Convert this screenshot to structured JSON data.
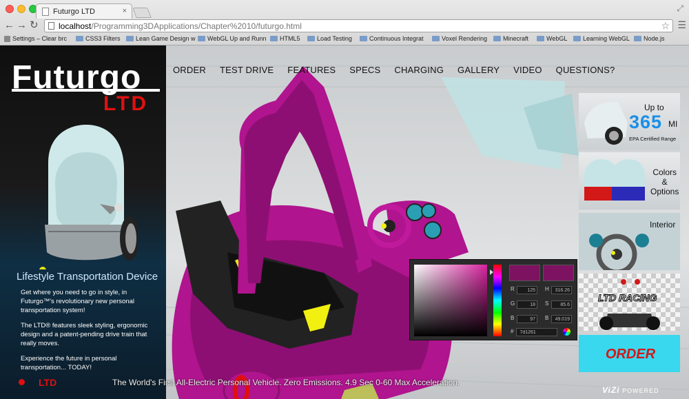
{
  "browser": {
    "tab_title": "Futurgo LTD",
    "tab_close": "×",
    "url_host": "localhost",
    "url_path": "/Programming3DApplications/Chapter%2010/futurgo.html",
    "bookmarks": [
      "Settings – Clear brc",
      "CSS3 Filters",
      "Lean Game Design w",
      "WebGL Up and Runn",
      "HTML5",
      "Load Testing",
      "Continuous Integrat",
      "Voxel Rendering",
      "Minecraft",
      "WebGL",
      "Learning WebGL",
      "Node.js"
    ]
  },
  "sidebar": {
    "logo": "Futurgo",
    "logo_sub": "LTD",
    "tagline": "Lifestyle Transportation Device",
    "paragraphs": [
      "Get where you need to go in style, in Futurgo™'s revolutionary new personal transportation system!",
      "The LTD® features sleek styling, ergonomic design and a patent-pending drive train that really moves.",
      "Experience the future in personal transportation... TODAY!"
    ],
    "footer_label": "LTD"
  },
  "nav": [
    "ORDER",
    "TEST DRIVE",
    "FEATURES",
    "SPECS",
    "CHARGING",
    "GALLERY",
    "VIDEO",
    "QUESTIONS?"
  ],
  "color_picker": {
    "swatch_color": "#7d1261",
    "fields": [
      {
        "label": "R",
        "value": "125"
      },
      {
        "label": "H",
        "value": "316.26"
      },
      {
        "label": "G",
        "value": "18"
      },
      {
        "label": "S",
        "value": "85.6"
      },
      {
        "label": "B",
        "value": "97"
      },
      {
        "label": "B",
        "value": "49.019"
      }
    ],
    "hex_label": "#",
    "hex_value": "7d1261"
  },
  "cards": {
    "range": {
      "up_to": "Up to",
      "number": "365",
      "unit": "MI",
      "sub": "EPA Certified Range"
    },
    "colors": {
      "line1": "Colors",
      "line2": "&",
      "line3": "Options"
    },
    "interior": {
      "title": "Interior"
    },
    "racing": {
      "title": "LTD RACING"
    },
    "order": {
      "title": "ORDER"
    }
  },
  "footer": {
    "tagline": "The World's First All-Electric Personal Vehicle. Zero Emissions. 4.9 Sec 0-60 Max Acceleration.",
    "brand": "ViZi",
    "powered": "POWERED"
  },
  "colors": {
    "car_magenta": "#b0148e",
    "accent_red": "#e01010",
    "accent_blue": "#1a8fe8",
    "order_bg": "#39d8ef"
  }
}
